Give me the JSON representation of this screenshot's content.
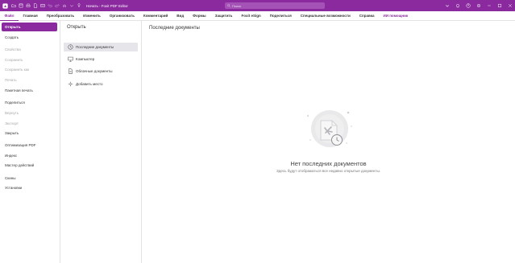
{
  "window": {
    "title": "Начать - Foxit PDF Editor",
    "search_placeholder": "Поиск"
  },
  "menu": {
    "tabs": [
      {
        "label": "Файл"
      },
      {
        "label": "Главная"
      },
      {
        "label": "Преобразовать"
      },
      {
        "label": "Изменить"
      },
      {
        "label": "Организовать"
      },
      {
        "label": "Комментарий"
      },
      {
        "label": "Вид"
      },
      {
        "label": "Формы"
      },
      {
        "label": "Защитить"
      },
      {
        "label": "Foxit eSign"
      },
      {
        "label": "Поделиться"
      },
      {
        "label": "Специальные возможности"
      },
      {
        "label": "Справка"
      },
      {
        "label": "ИИ помощник"
      }
    ]
  },
  "sidebar": {
    "items": [
      {
        "label": "Открыть"
      },
      {
        "label": "Создать"
      },
      {
        "label": "Свойства"
      },
      {
        "label": "Сохранить"
      },
      {
        "label": "Сохранить как"
      },
      {
        "label": "Печать"
      },
      {
        "label": "Пакетная печать"
      },
      {
        "label": "Поделиться"
      },
      {
        "label": "Вернуть"
      },
      {
        "label": "Экспорт"
      },
      {
        "label": "Закрыть"
      },
      {
        "label": "Оптимизация PDF"
      },
      {
        "label": "Индекс"
      },
      {
        "label": "Мастер действий"
      },
      {
        "label": "Скины"
      },
      {
        "label": "Установки"
      }
    ]
  },
  "open_panel": {
    "title": "Открыть",
    "locations": [
      {
        "label": "Последние документы"
      },
      {
        "label": "Компьютер"
      },
      {
        "label": "Облачные документы"
      },
      {
        "label": "Добавить место"
      }
    ]
  },
  "main": {
    "title": "Последние документы",
    "empty_title": "Нет последних документов",
    "empty_subtitle": "Здесь будут отображаться все недавно открытые документы."
  },
  "colors": {
    "accent": "#8a2a9e",
    "title_bar": "#8a2a9e"
  }
}
